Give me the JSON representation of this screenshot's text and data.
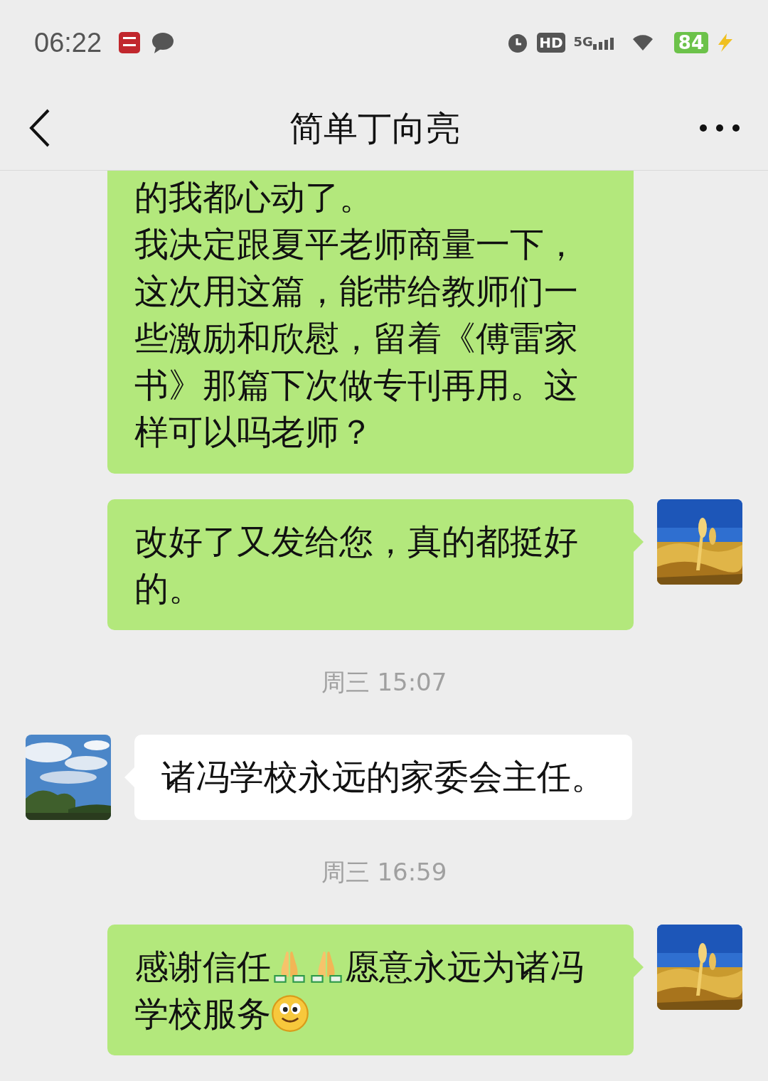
{
  "status_bar": {
    "time": "06:22",
    "hd": "HD",
    "network": "5G",
    "battery": "84"
  },
  "header": {
    "title": "简单丁向亮"
  },
  "messages": [
    {
      "kind": "sent",
      "cut_top": true,
      "avatar": false,
      "segments": [
        {
          "kind": "text",
          "text": "的我都心动了。"
        },
        {
          "kind": "break"
        },
        {
          "kind": "text",
          "text": "我决定跟夏平老师商量一下，"
        },
        {
          "kind": "break"
        },
        {
          "kind": "text",
          "text": "这次用这篇，能带给教师们一些激励和欣慰，留着《傅雷家书》那篇下次做专刊再用。这样可以吗老师？"
        }
      ]
    },
    {
      "kind": "sent",
      "cut_top": false,
      "avatar": true,
      "segments": [
        {
          "kind": "text",
          "text": "改好了又发给您，真的都挺好的。"
        }
      ]
    },
    {
      "kind": "time",
      "text": "周三 15:07"
    },
    {
      "kind": "received",
      "cut_top": false,
      "avatar": true,
      "segments": [
        {
          "kind": "text",
          "text": "诸冯学校永远的家委会主任。"
        }
      ]
    },
    {
      "kind": "time",
      "text": "周三 16:59"
    },
    {
      "kind": "sent",
      "cut_top": false,
      "avatar": true,
      "segments": [
        {
          "kind": "text",
          "text": "感谢信任"
        },
        {
          "kind": "pray"
        },
        {
          "kind": "pray"
        },
        {
          "kind": "text",
          "text": "愿意永远为诸冯学校服务"
        },
        {
          "kind": "smile"
        }
      ]
    }
  ]
}
